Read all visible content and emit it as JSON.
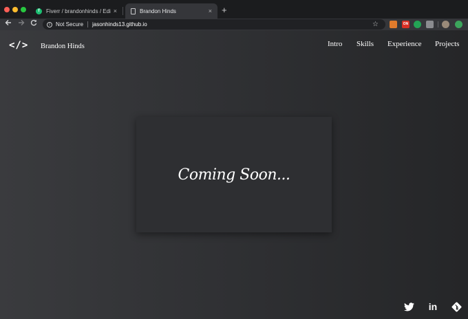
{
  "browser": {
    "tabs": [
      {
        "title": "Fiverr / brandonhinds / Edit Gig",
        "favicon": "fiverr-icon",
        "active": false
      },
      {
        "title": "Brandon Hinds",
        "favicon": "document-icon",
        "active": true
      }
    ],
    "close_glyph": "×",
    "new_tab_glyph": "+",
    "security_label": "Not Secure",
    "url": "jasonhinds13.github.io",
    "extensions": [
      "extension-orange-icon",
      "extension-red-icon",
      "extension-green-icon",
      "extension-gray-icon",
      "profile-avatar-icon",
      "extension-green-leaf-icon"
    ],
    "ext2_text": "ON"
  },
  "site": {
    "logo": "</>",
    "brand": "Brandon Hinds",
    "nav": [
      "Intro",
      "Skills",
      "Experience",
      "Projects"
    ],
    "headline": "Coming Soon...",
    "social": [
      "twitter-icon",
      "linkedin-icon",
      "git-icon"
    ],
    "linkedin_text": "in"
  },
  "colors": {
    "page_bg": "#303134",
    "card_bg": "#2e2f32",
    "text": "#ffffff",
    "tab_active": "#35363a"
  }
}
